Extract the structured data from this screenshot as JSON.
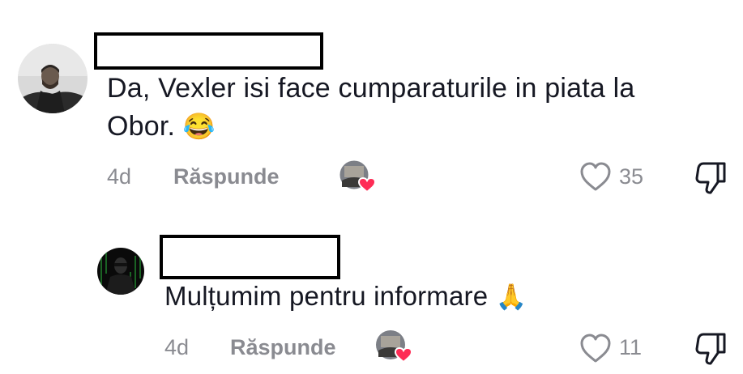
{
  "comments": [
    {
      "text_line1": "Da, Vexler isi face cumparaturile in piata la",
      "text_line2": "Obor.",
      "emoji": "😂",
      "time": "4d",
      "reply_label": "Răspunde",
      "likes": "35"
    },
    {
      "text": "Mulțumim pentru informare",
      "emoji": "🙏",
      "time": "4d",
      "reply_label": "Răspunde",
      "likes": "11"
    }
  ],
  "icons": {
    "like": "heart-outline-icon",
    "dislike": "thumbs-down-icon",
    "creator_liked": "heart-badge-icon"
  },
  "colors": {
    "text": "#161823",
    "muted": "#8a8b91",
    "heart_badge": "#fe2c55"
  }
}
